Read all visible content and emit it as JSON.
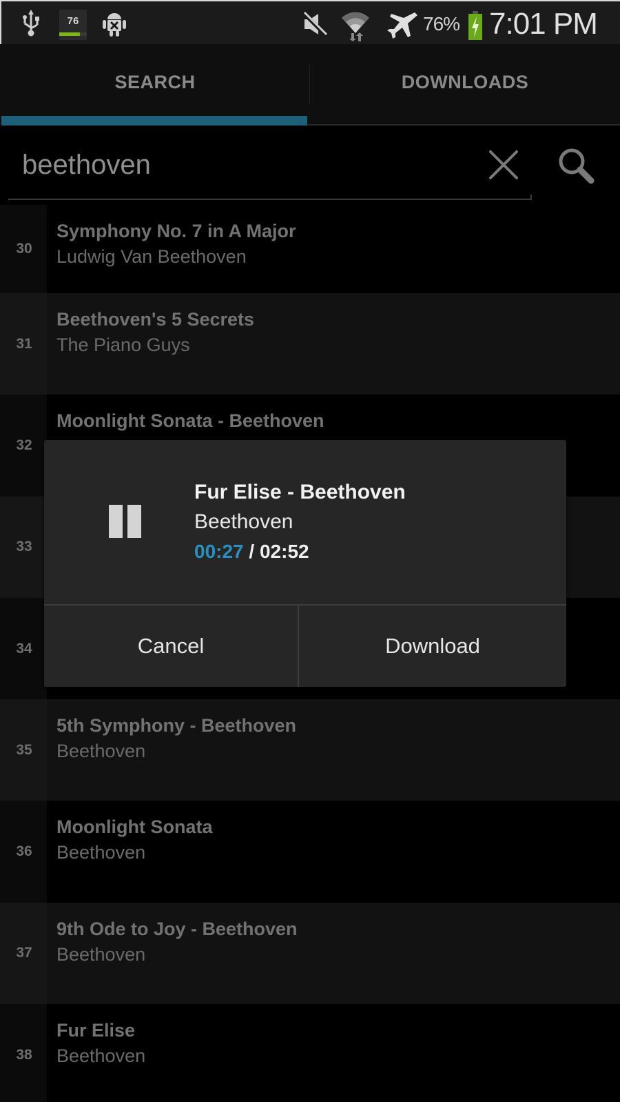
{
  "status_bar": {
    "notification_number": "76",
    "notification_progress": 0.75,
    "battery_percent": "76%",
    "battery_level": 0.76,
    "time": "7:01 PM",
    "icons": [
      "usb-icon",
      "notification-76-icon",
      "android-debug-icon",
      "mute-icon",
      "wifi-icon",
      "airplane-icon",
      "battery-charging-icon"
    ]
  },
  "tabs": [
    {
      "label": "SEARCH",
      "active": true
    },
    {
      "label": "DOWNLOADS",
      "active": false
    }
  ],
  "search": {
    "value": "beethoven",
    "clear_icon": "close-icon",
    "search_icon": "search-icon"
  },
  "results": [
    {
      "num": "30",
      "title": "Symphony No. 7 in A Major",
      "artist": "Ludwig Van Beethoven"
    },
    {
      "num": "31",
      "title": "Beethoven's 5 Secrets",
      "artist": "The Piano Guys"
    },
    {
      "num": "32",
      "title": "Moonlight Sonata - Beethoven",
      "artist": ""
    },
    {
      "num": "33",
      "title": "",
      "artist": ""
    },
    {
      "num": "34",
      "title": "",
      "artist": ""
    },
    {
      "num": "35",
      "title": "5th Symphony - Beethoven",
      "artist": "Beethoven"
    },
    {
      "num": "36",
      "title": "Moonlight Sonata",
      "artist": "Beethoven"
    },
    {
      "num": "37",
      "title": "9th Ode to Joy - Beethoven",
      "artist": "Beethoven"
    },
    {
      "num": "38",
      "title": "Fur Elise",
      "artist": "Beethoven"
    }
  ],
  "player_dialog": {
    "title": "Fur Elise - Beethoven",
    "artist": "Beethoven",
    "elapsed": "00:27",
    "separator": " / ",
    "duration": "02:52",
    "state_icon": "pause-icon",
    "colors": {
      "elapsed": "#2a8fc0"
    },
    "buttons": {
      "cancel": "Cancel",
      "download": "Download"
    }
  },
  "colors": {
    "tab_indicator": "#1e5f7a",
    "battery_green": "#6aaa1a"
  }
}
